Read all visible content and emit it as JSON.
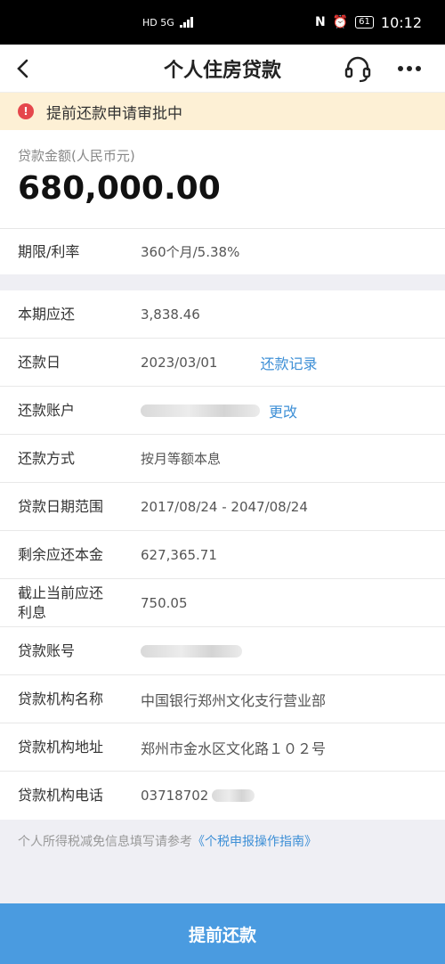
{
  "status_bar": {
    "network": "HD 5G",
    "battery": "61",
    "time": "10:12"
  },
  "nav": {
    "title": "个人住房贷款",
    "back_icon": "back-arrow-icon",
    "support_icon": "headset-icon",
    "more_icon": "more-dots-icon"
  },
  "alert": {
    "text": "提前还款申请审批中",
    "icon": "alert-circle-icon",
    "color": "#e5474c"
  },
  "loan_amount": {
    "label": "贷款金额(人民币元)",
    "value": "680,000.00"
  },
  "term": {
    "label": "期限/利率",
    "value": "360个月/5.38%"
  },
  "details": {
    "current_due": {
      "label": "本期应还",
      "value": "3,838.46"
    },
    "repay_date": {
      "label": "还款日",
      "value": "2023/03/01",
      "link": "还款记录"
    },
    "repay_account": {
      "label": "还款账户",
      "link": "更改"
    },
    "repay_method": {
      "label": "还款方式",
      "value": "按月等额本息"
    },
    "date_range": {
      "label": "贷款日期范围",
      "value": "2017/08/24 - 2047/08/24"
    },
    "remaining_principal": {
      "label": "剩余应还本金",
      "value": "627,365.71"
    },
    "interest_due": {
      "label": "截止当前应还\n利息",
      "value": "750.05"
    },
    "loan_account": {
      "label": "贷款账号"
    },
    "institution_name": {
      "label": "贷款机构名称",
      "value": "中国银行郑州文化支行营业部"
    },
    "institution_address": {
      "label": "贷款机构地址",
      "value": "郑州市金水区文化路１０２号"
    },
    "institution_phone": {
      "label": "贷款机构电话",
      "value": "03718702"
    }
  },
  "footnote": {
    "text": "个人所得税减免信息填写请参考",
    "link": "《个税申报操作指南》"
  },
  "bottom_button": {
    "label": "提前还款",
    "color": "#4a9be0"
  }
}
